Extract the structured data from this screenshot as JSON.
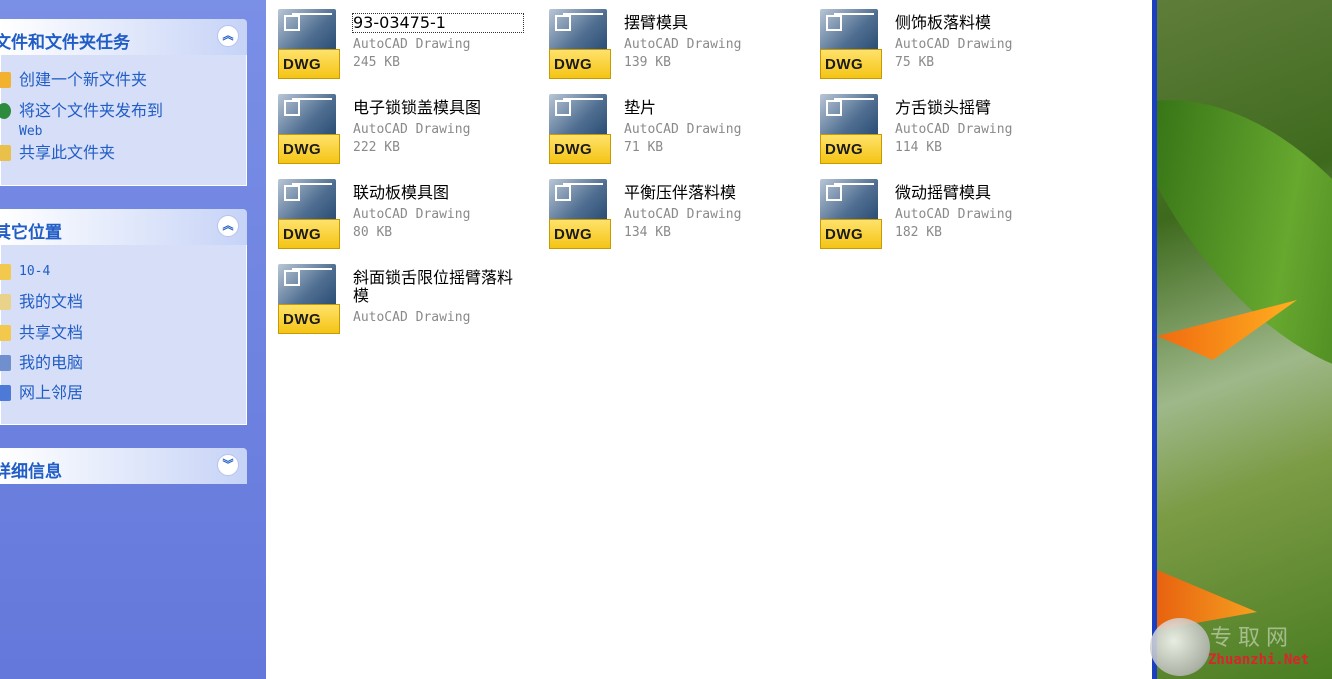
{
  "task_pane": {
    "panels": [
      {
        "title": "文件和文件夹任务",
        "items": [
          {
            "label": "创建一个新文件夹",
            "icon": "new-folder-icon"
          },
          {
            "label": "将这个文件夹发布到",
            "label2": "Web",
            "icon": "publish-web-icon"
          },
          {
            "label": "共享此文件夹",
            "icon": "share-folder-icon"
          }
        ]
      },
      {
        "title": "其它位置",
        "items": [
          {
            "label": "10-4",
            "icon": "folder-icon"
          },
          {
            "label": "我的文档",
            "icon": "my-documents-icon"
          },
          {
            "label": "共享文档",
            "icon": "shared-documents-icon"
          },
          {
            "label": "我的电脑",
            "icon": "my-computer-icon"
          },
          {
            "label": "网上邻居",
            "icon": "network-places-icon"
          }
        ]
      },
      {
        "title": "详细信息",
        "items": []
      }
    ]
  },
  "files": [
    {
      "name": "93-03475-1",
      "type": "AutoCAD Drawing",
      "size": "245 KB",
      "icon_text": "DWG"
    },
    {
      "name": "摆臂模具",
      "type": "AutoCAD Drawing",
      "size": "139 KB",
      "icon_text": "DWG"
    },
    {
      "name": "侧饰板落料模",
      "type": "AutoCAD Drawing",
      "size": "75 KB",
      "icon_text": "DWG"
    },
    {
      "name": "电子锁锁盖模具图",
      "type": "AutoCAD Drawing",
      "size": "222 KB",
      "icon_text": "DWG"
    },
    {
      "name": "垫片",
      "type": "AutoCAD Drawing",
      "size": "71 KB",
      "icon_text": "DWG"
    },
    {
      "name": "方舌锁头摇臂",
      "type": "AutoCAD Drawing",
      "size": "114 KB",
      "icon_text": "DWG"
    },
    {
      "name": "联动板模具图",
      "type": "AutoCAD Drawing",
      "size": "80 KB",
      "icon_text": "DWG"
    },
    {
      "name": "平衡压伴落料模",
      "type": "AutoCAD Drawing",
      "size": "134 KB",
      "icon_text": "DWG"
    },
    {
      "name": "微动摇臂模具",
      "type": "AutoCAD Drawing",
      "size": "182 KB",
      "icon_text": "DWG"
    },
    {
      "name": "斜面锁舌限位摇臂落料模",
      "type": "AutoCAD Drawing",
      "size": "",
      "icon_text": "DWG"
    }
  ],
  "watermark": {
    "text_cn": "专取网",
    "text_en": "Zhuanzhi.Net"
  },
  "colors": {
    "task_link": "#215dc6",
    "pane_bg": "#6b7fd8",
    "frame": "#1b3fbf"
  }
}
